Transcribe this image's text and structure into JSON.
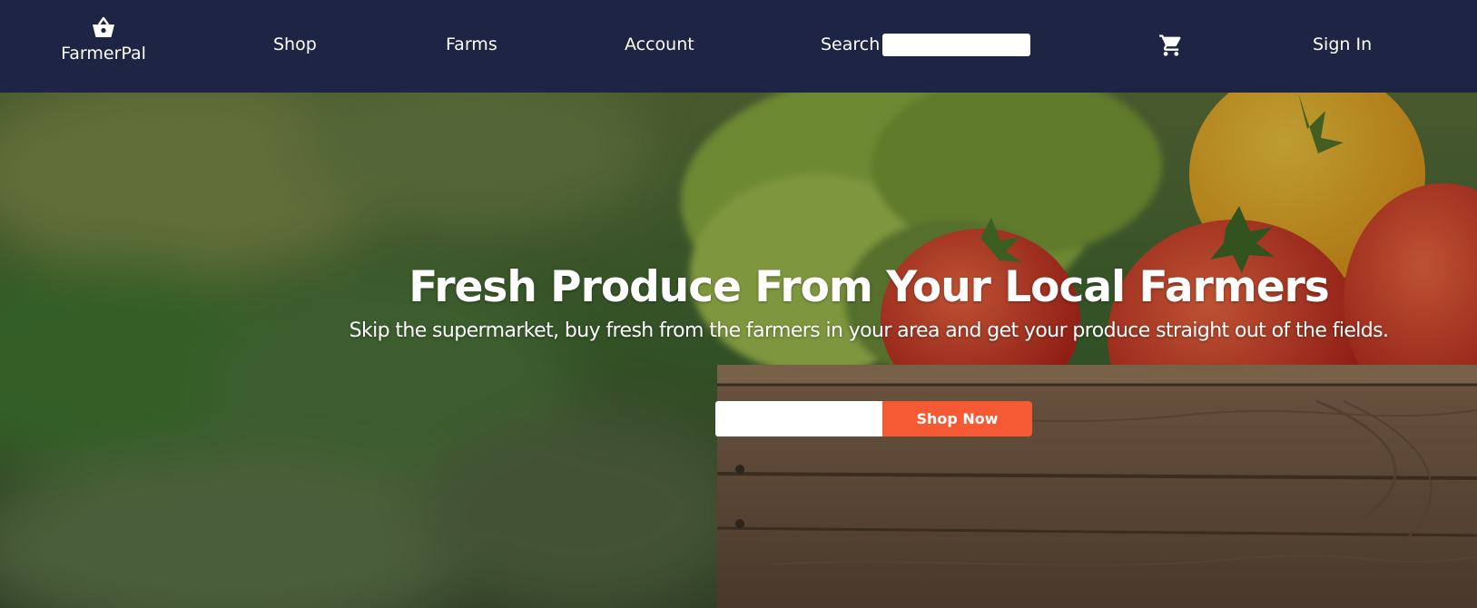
{
  "brand": {
    "name": "FarmerPal",
    "icon": "basket-icon"
  },
  "nav": {
    "links": [
      "Shop",
      "Farms",
      "Account"
    ],
    "search_label": "Search",
    "search_placeholder": "",
    "cart_icon": "shopping-cart-icon",
    "sign_in": "Sign In"
  },
  "hero": {
    "title": "Fresh Produce From Your Local Farmers",
    "subtitle": "Skip the supermarket, buy fresh from the farmers in your area and get your produce straight out of the fields.",
    "input_placeholder": "",
    "cta_label": "Shop Now"
  },
  "colors": {
    "nav_background": "#1e2444",
    "cta": "#f55a35",
    "text": "#ffffff"
  }
}
